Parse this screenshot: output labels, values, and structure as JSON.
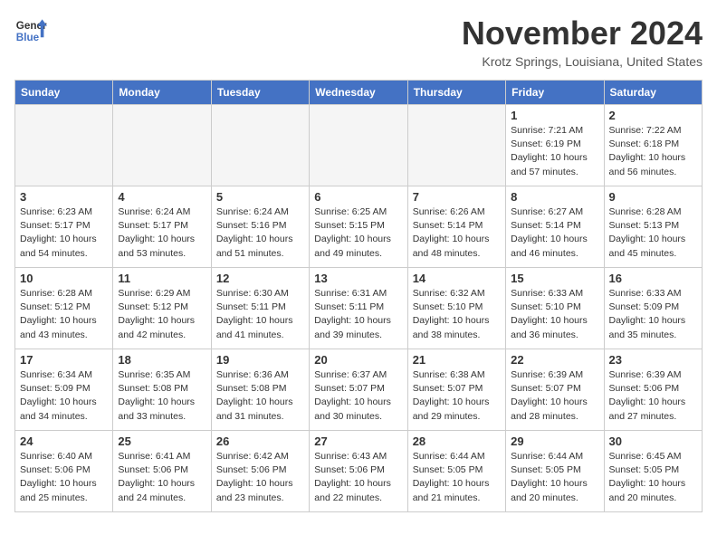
{
  "header": {
    "logo_line1": "General",
    "logo_line2": "Blue",
    "month": "November 2024",
    "location": "Krotz Springs, Louisiana, United States"
  },
  "weekdays": [
    "Sunday",
    "Monday",
    "Tuesday",
    "Wednesday",
    "Thursday",
    "Friday",
    "Saturday"
  ],
  "weeks": [
    [
      {
        "day": "",
        "info": ""
      },
      {
        "day": "",
        "info": ""
      },
      {
        "day": "",
        "info": ""
      },
      {
        "day": "",
        "info": ""
      },
      {
        "day": "",
        "info": ""
      },
      {
        "day": "1",
        "info": "Sunrise: 7:21 AM\nSunset: 6:19 PM\nDaylight: 10 hours\nand 57 minutes."
      },
      {
        "day": "2",
        "info": "Sunrise: 7:22 AM\nSunset: 6:18 PM\nDaylight: 10 hours\nand 56 minutes."
      }
    ],
    [
      {
        "day": "3",
        "info": "Sunrise: 6:23 AM\nSunset: 5:17 PM\nDaylight: 10 hours\nand 54 minutes."
      },
      {
        "day": "4",
        "info": "Sunrise: 6:24 AM\nSunset: 5:17 PM\nDaylight: 10 hours\nand 53 minutes."
      },
      {
        "day": "5",
        "info": "Sunrise: 6:24 AM\nSunset: 5:16 PM\nDaylight: 10 hours\nand 51 minutes."
      },
      {
        "day": "6",
        "info": "Sunrise: 6:25 AM\nSunset: 5:15 PM\nDaylight: 10 hours\nand 49 minutes."
      },
      {
        "day": "7",
        "info": "Sunrise: 6:26 AM\nSunset: 5:14 PM\nDaylight: 10 hours\nand 48 minutes."
      },
      {
        "day": "8",
        "info": "Sunrise: 6:27 AM\nSunset: 5:14 PM\nDaylight: 10 hours\nand 46 minutes."
      },
      {
        "day": "9",
        "info": "Sunrise: 6:28 AM\nSunset: 5:13 PM\nDaylight: 10 hours\nand 45 minutes."
      }
    ],
    [
      {
        "day": "10",
        "info": "Sunrise: 6:28 AM\nSunset: 5:12 PM\nDaylight: 10 hours\nand 43 minutes."
      },
      {
        "day": "11",
        "info": "Sunrise: 6:29 AM\nSunset: 5:12 PM\nDaylight: 10 hours\nand 42 minutes."
      },
      {
        "day": "12",
        "info": "Sunrise: 6:30 AM\nSunset: 5:11 PM\nDaylight: 10 hours\nand 41 minutes."
      },
      {
        "day": "13",
        "info": "Sunrise: 6:31 AM\nSunset: 5:11 PM\nDaylight: 10 hours\nand 39 minutes."
      },
      {
        "day": "14",
        "info": "Sunrise: 6:32 AM\nSunset: 5:10 PM\nDaylight: 10 hours\nand 38 minutes."
      },
      {
        "day": "15",
        "info": "Sunrise: 6:33 AM\nSunset: 5:10 PM\nDaylight: 10 hours\nand 36 minutes."
      },
      {
        "day": "16",
        "info": "Sunrise: 6:33 AM\nSunset: 5:09 PM\nDaylight: 10 hours\nand 35 minutes."
      }
    ],
    [
      {
        "day": "17",
        "info": "Sunrise: 6:34 AM\nSunset: 5:09 PM\nDaylight: 10 hours\nand 34 minutes."
      },
      {
        "day": "18",
        "info": "Sunrise: 6:35 AM\nSunset: 5:08 PM\nDaylight: 10 hours\nand 33 minutes."
      },
      {
        "day": "19",
        "info": "Sunrise: 6:36 AM\nSunset: 5:08 PM\nDaylight: 10 hours\nand 31 minutes."
      },
      {
        "day": "20",
        "info": "Sunrise: 6:37 AM\nSunset: 5:07 PM\nDaylight: 10 hours\nand 30 minutes."
      },
      {
        "day": "21",
        "info": "Sunrise: 6:38 AM\nSunset: 5:07 PM\nDaylight: 10 hours\nand 29 minutes."
      },
      {
        "day": "22",
        "info": "Sunrise: 6:39 AM\nSunset: 5:07 PM\nDaylight: 10 hours\nand 28 minutes."
      },
      {
        "day": "23",
        "info": "Sunrise: 6:39 AM\nSunset: 5:06 PM\nDaylight: 10 hours\nand 27 minutes."
      }
    ],
    [
      {
        "day": "24",
        "info": "Sunrise: 6:40 AM\nSunset: 5:06 PM\nDaylight: 10 hours\nand 25 minutes."
      },
      {
        "day": "25",
        "info": "Sunrise: 6:41 AM\nSunset: 5:06 PM\nDaylight: 10 hours\nand 24 minutes."
      },
      {
        "day": "26",
        "info": "Sunrise: 6:42 AM\nSunset: 5:06 PM\nDaylight: 10 hours\nand 23 minutes."
      },
      {
        "day": "27",
        "info": "Sunrise: 6:43 AM\nSunset: 5:06 PM\nDaylight: 10 hours\nand 22 minutes."
      },
      {
        "day": "28",
        "info": "Sunrise: 6:44 AM\nSunset: 5:05 PM\nDaylight: 10 hours\nand 21 minutes."
      },
      {
        "day": "29",
        "info": "Sunrise: 6:44 AM\nSunset: 5:05 PM\nDaylight: 10 hours\nand 20 minutes."
      },
      {
        "day": "30",
        "info": "Sunrise: 6:45 AM\nSunset: 5:05 PM\nDaylight: 10 hours\nand 20 minutes."
      }
    ]
  ]
}
